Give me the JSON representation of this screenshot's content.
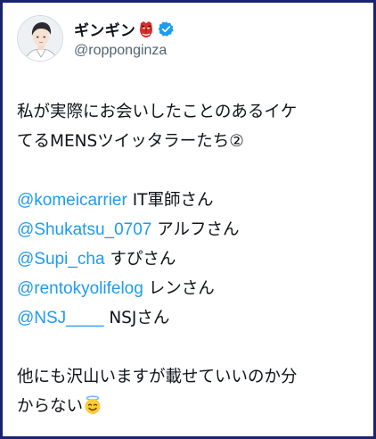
{
  "tweet": {
    "author": {
      "display_name": "ギンギン",
      "name_emoji_icon": "tengu-mask-icon",
      "verified_icon": "verified-badge-icon",
      "handle": "@ropponginza",
      "avatar_icon": "avatar-portrait-illustration"
    },
    "body": {
      "line1": "私が実際にお会いしたことのあるイケ",
      "line2": "てるMENSツイッタラーたち②",
      "mentions": [
        {
          "handle": "@komeicarrier",
          "suffix": " IT軍師さん"
        },
        {
          "handle": "@Shukatsu_0707",
          "suffix": " アルフさん"
        },
        {
          "handle": "@Supi_cha",
          "suffix": " すぴさん"
        },
        {
          "handle": "@rentokyolifelog",
          "suffix": " レンさん"
        },
        {
          "handle": "@NSJ____",
          "suffix": " NSJさん"
        }
      ],
      "closing_line1": "他にも沢山いますが載せていいのか分",
      "closing_line2": "からない",
      "closing_emoji_icon": "smiling-face-with-halo-icon"
    },
    "colors": {
      "mention": "#1d9bf0",
      "text": "#0f1419",
      "secondary": "#536471",
      "verified": "#1d9bf0",
      "frame_border": "#1a2370"
    }
  }
}
